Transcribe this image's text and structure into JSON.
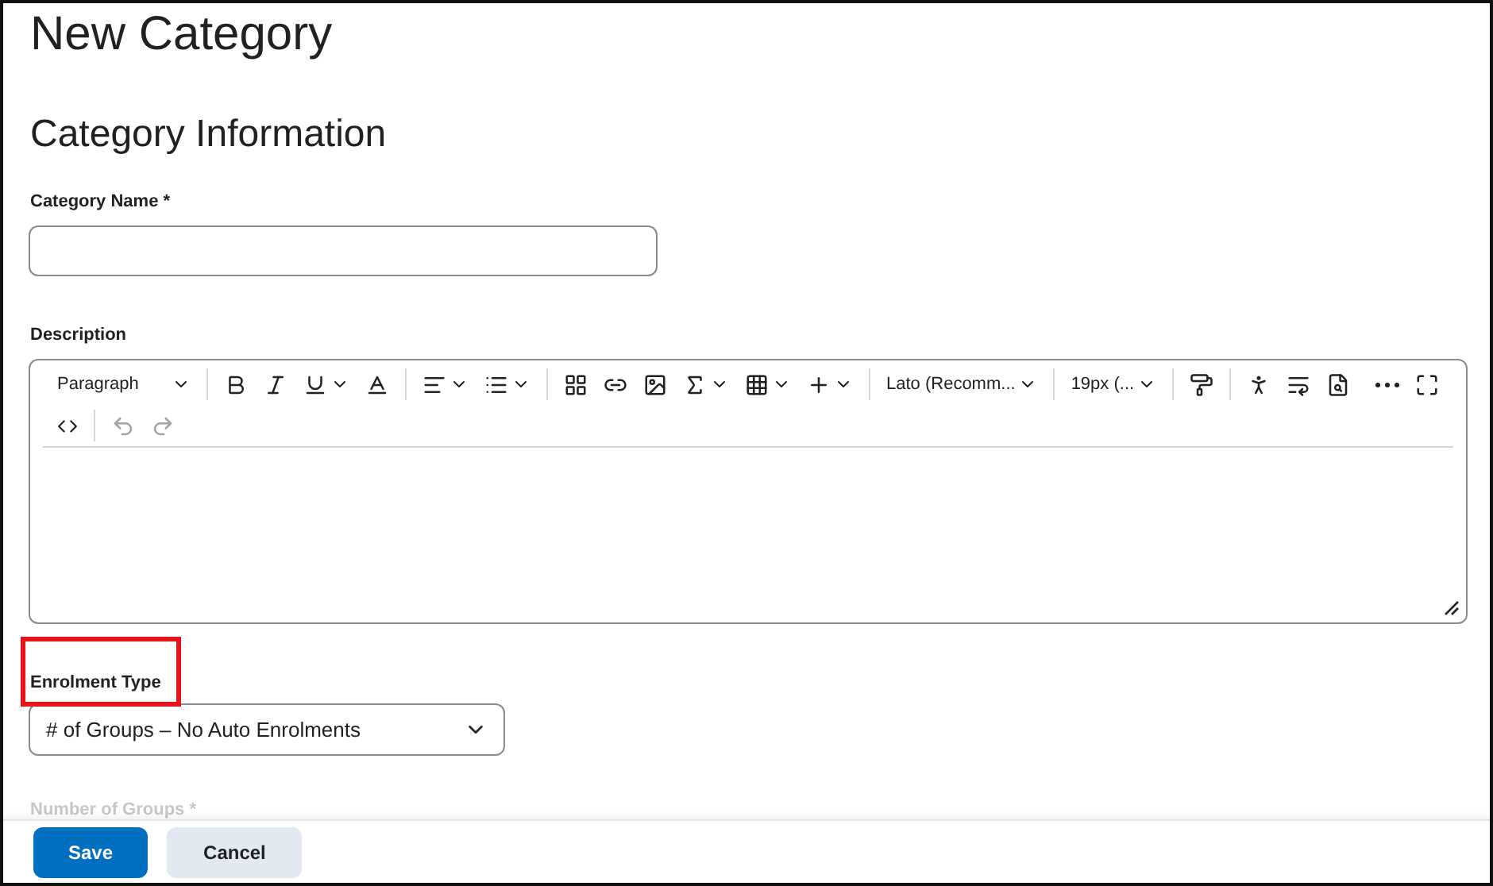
{
  "page_title": "New Category",
  "section_title": "Category Information",
  "category_name": {
    "label": "Category Name",
    "required_mark": "*"
  },
  "description": {
    "label": "Description",
    "toolbar": {
      "block_format": "Paragraph",
      "font": "Lato (Recomm...",
      "size": "19px (..."
    }
  },
  "enrolment_type": {
    "label": "Enrolment Type",
    "highlighted": true,
    "value": "# of Groups – No Auto Enrolments"
  },
  "number_of_groups": {
    "label": "Number of Groups *"
  },
  "buttons": [
    {
      "label": "Save",
      "kind": "primary"
    },
    {
      "label": "Cancel",
      "kind": "secondary"
    }
  ]
}
